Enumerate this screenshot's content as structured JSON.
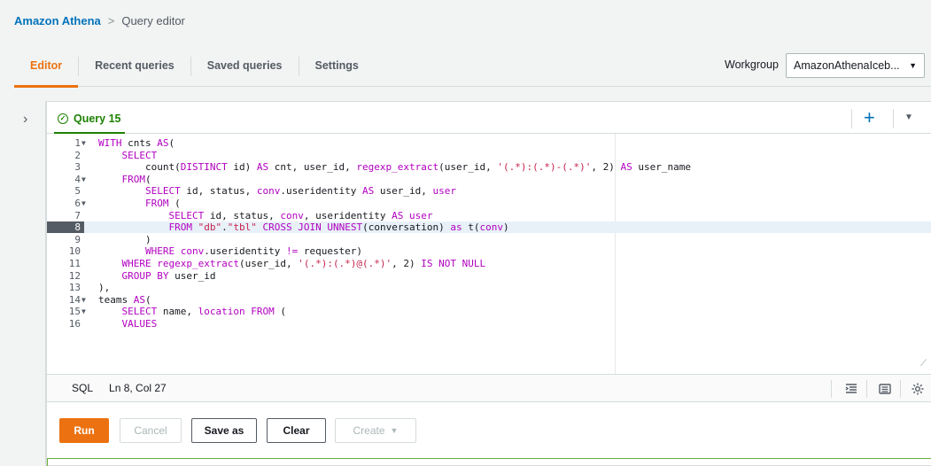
{
  "breadcrumb": {
    "root": "Amazon Athena",
    "separator": ">",
    "current": "Query editor"
  },
  "tabs": [
    {
      "label": "Editor",
      "active": true
    },
    {
      "label": "Recent queries",
      "active": false
    },
    {
      "label": "Saved queries",
      "active": false
    },
    {
      "label": "Settings",
      "active": false
    }
  ],
  "workgroup": {
    "label": "Workgroup",
    "value": "AmazonAthenaIceb..."
  },
  "query_tab": {
    "label": "Query 15",
    "status": "success"
  },
  "icons": {
    "add": "+",
    "tab_menu": "▼",
    "panel_toggle": "›"
  },
  "editor": {
    "lines": [
      {
        "n": "1",
        "fold": true,
        "html": "<span class=\"kw\">WITH</span> cnts <span class=\"kw\">AS</span>("
      },
      {
        "n": "2",
        "fold": false,
        "html": "    <span class=\"kw\">SELECT</span>"
      },
      {
        "n": "3",
        "fold": false,
        "html": "        count(<span class=\"kw\">DISTINCT</span> id) <span class=\"kw\">AS</span> cnt, user_id, <span class=\"kw\">regexp_extract</span>(user_id, <span class=\"str\">'(.*):(.*)-(.*)'</span>, 2) <span class=\"kw\">AS</span> user_name"
      },
      {
        "n": "4",
        "fold": true,
        "html": "    <span class=\"kw\">FROM</span>("
      },
      {
        "n": "5",
        "fold": false,
        "html": "        <span class=\"kw\">SELECT</span> id, status, <span class=\"kw\">conv</span>.useridentity <span class=\"kw\">AS</span> user_id, <span class=\"kw\">user</span>"
      },
      {
        "n": "6",
        "fold": true,
        "html": "        <span class=\"kw\">FROM</span> ("
      },
      {
        "n": "7",
        "fold": false,
        "html": "            <span class=\"kw\">SELECT</span> id, status, <span class=\"kw\">conv</span>, useridentity <span class=\"kw\">AS</span> <span class=\"kw\">user</span>"
      },
      {
        "n": "8",
        "fold": false,
        "active": true,
        "html": "            <span class=\"kw\">FROM</span> <span class=\"str\">\"db\"</span>.<span class=\"str\">\"tbl\"</span> <span class=\"kw\">CROSS JOIN UNNEST</span>(conversation) <span class=\"kw\">as</span> t(<span class=\"kw\">conv</span>)"
      },
      {
        "n": "9",
        "fold": false,
        "html": "        )"
      },
      {
        "n": "10",
        "fold": false,
        "html": "        <span class=\"kw\">WHERE</span> <span class=\"kw\">conv</span>.useridentity <span class=\"kw\">!=</span> requester)"
      },
      {
        "n": "11",
        "fold": false,
        "html": "    <span class=\"kw\">WHERE</span> <span class=\"kw\">regexp_extract</span>(user_id, <span class=\"str\">'(.*):(.*)@(.*)'</span>, 2) <span class=\"kw\">IS NOT NULL</span>"
      },
      {
        "n": "12",
        "fold": false,
        "html": "    <span class=\"kw\">GROUP BY</span> user_id"
      },
      {
        "n": "13",
        "fold": false,
        "html": "),"
      },
      {
        "n": "14",
        "fold": true,
        "html": "teams <span class=\"kw\">AS</span>("
      },
      {
        "n": "15",
        "fold": true,
        "html": "    <span class=\"kw\">SELECT</span> name, <span class=\"kw\">location</span> <span class=\"kw\">FROM</span> ("
      },
      {
        "n": "16",
        "fold": false,
        "html": "    <span class=\"kw\">VALUES</span>"
      }
    ]
  },
  "status_bar": {
    "language": "SQL",
    "cursor": "Ln 8, Col 27"
  },
  "buttons": {
    "run": "Run",
    "cancel": "Cancel",
    "save_as": "Save as",
    "clear": "Clear",
    "create": "Create",
    "create_caret": "▼"
  },
  "colors": {
    "accent": "#ec7211",
    "link": "#0073bb",
    "success": "#1d8102"
  }
}
